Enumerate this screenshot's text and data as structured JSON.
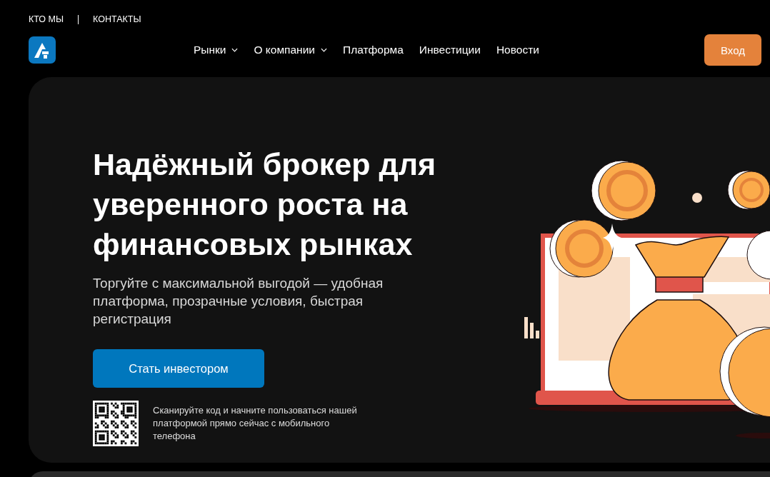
{
  "top_links": [
    "КТО МЫ",
    "КОНТАКТЫ"
  ],
  "nav": [
    {
      "label": "Рынки",
      "dropdown": true
    },
    {
      "label": "О компании",
      "dropdown": true
    },
    {
      "label": "Платформа",
      "dropdown": false
    },
    {
      "label": "Инвестиции",
      "dropdown": false
    },
    {
      "label": "Новости",
      "dropdown": false
    }
  ],
  "login_button": "Вход",
  "hero": {
    "title": "Надёжный брокер для уверенного роста на финансовых рынках",
    "subtitle": "Торгуйте с максимальной выгодой — удобная платформа, прозрачные условия, быстрая регистрация",
    "cta": "Стать инвестором",
    "qr_text": "Сканируйте код и начните пользоваться нашей платформой прямо сейчас с мобильного телефона"
  }
}
